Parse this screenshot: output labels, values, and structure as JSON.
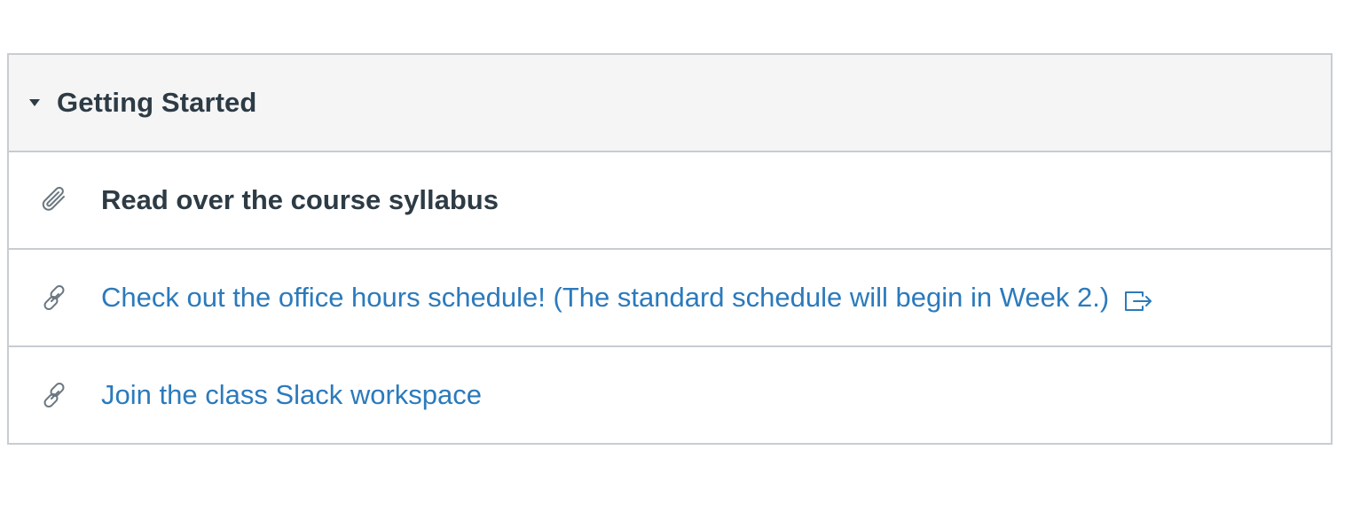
{
  "module": {
    "title": "Getting Started",
    "items": [
      {
        "title": "Read over the course syllabus",
        "icon": "paperclip-icon",
        "type": "attachment"
      },
      {
        "title": "Check out the office hours schedule! (The standard schedule will begin in Week 2.)",
        "icon": "link-icon",
        "type": "external-link",
        "external_indicator": "external-link-icon"
      },
      {
        "title": "Join the class Slack workspace",
        "icon": "link-icon",
        "type": "link"
      }
    ]
  },
  "colors": {
    "link": "#2b7abc",
    "text": "#2d3b45",
    "border": "#c7cdd1",
    "header_bg": "#f5f5f5",
    "icon": "#6b7780"
  }
}
